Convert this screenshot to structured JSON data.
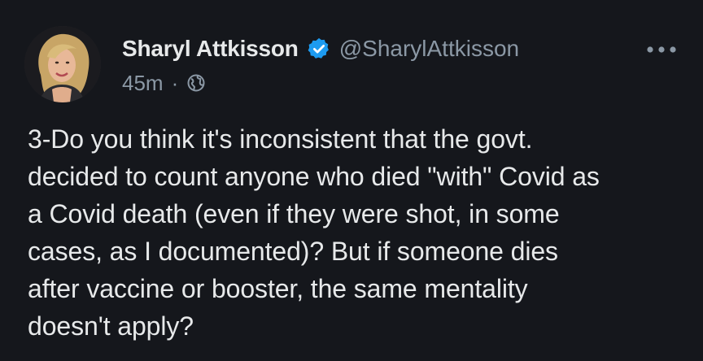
{
  "author": {
    "display_name": "Sharyl Attkisson",
    "handle": "@SharylAttkisson",
    "verified_icon": "verified-badge-icon",
    "avatar": "profile-avatar"
  },
  "meta": {
    "timestamp": "45m",
    "separator": "·",
    "visibility_icon": "globe-icon"
  },
  "actions": {
    "more_icon": "more-options-icon"
  },
  "tweet": {
    "lines": [
      "3-Do you think it's inconsistent that the govt.",
      "decided to count anyone who died \"with\" Covid as",
      "a Covid death (even if they were shot, in some",
      "cases, as I documented)? But if someone dies",
      "after vaccine or booster, the same mentality",
      "doesn't apply?"
    ]
  },
  "colors": {
    "background": "#15171c",
    "text": "#e7e9ea",
    "secondary": "#8b98a5",
    "verified": "#1d9bf0"
  }
}
